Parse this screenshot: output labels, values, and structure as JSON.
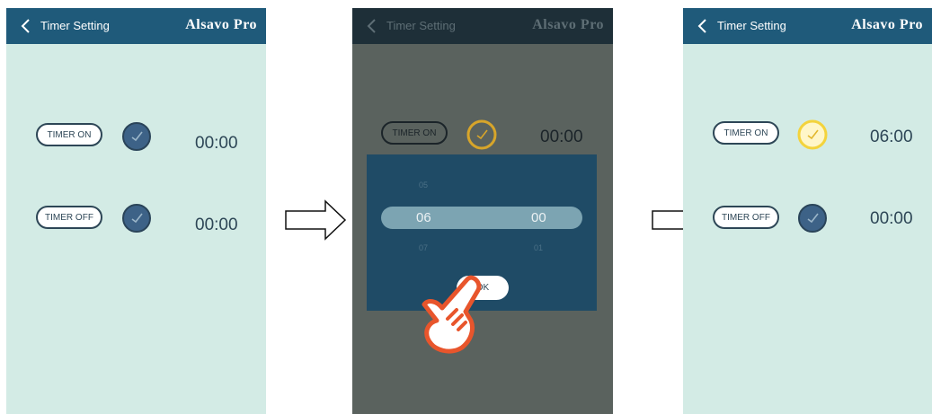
{
  "screens": [
    {
      "header": {
        "title": "Timer Setting",
        "brand": "Alsavo Pro"
      },
      "timer_on": {
        "label": "TIMER ON",
        "time": "00:00",
        "clock_color": "#3d6287"
      },
      "timer_off": {
        "label": "TIMER OFF",
        "time": "00:00",
        "clock_color": "#3d6287"
      }
    },
    {
      "header": {
        "title": "Timer Setting",
        "brand": "Alsavo Pro"
      },
      "timer_on": {
        "label": "TIMER ON",
        "time": "00:00",
        "clock_color": "#d7a52a"
      },
      "picker": {
        "hours": {
          "above": "05",
          "selected": "06",
          "below": "07"
        },
        "minutes": {
          "selected": "00",
          "below": "01"
        },
        "ok_label": "OK"
      }
    },
    {
      "header": {
        "title": "Timer Setting",
        "brand": "Alsavo Pro"
      },
      "timer_on": {
        "label": "TIMER ON",
        "time": "06:00",
        "clock_color": "#f3d33c"
      },
      "timer_off": {
        "label": "TIMER OFF",
        "time": "00:00",
        "clock_color": "#3d6287"
      }
    }
  ],
  "colors": {
    "header": "#1f5a7a",
    "screen_bg": "#d3ebe5",
    "dim_overlay": "#5a625e",
    "dialog": "#1f4b66",
    "hand": "#e8552c"
  }
}
